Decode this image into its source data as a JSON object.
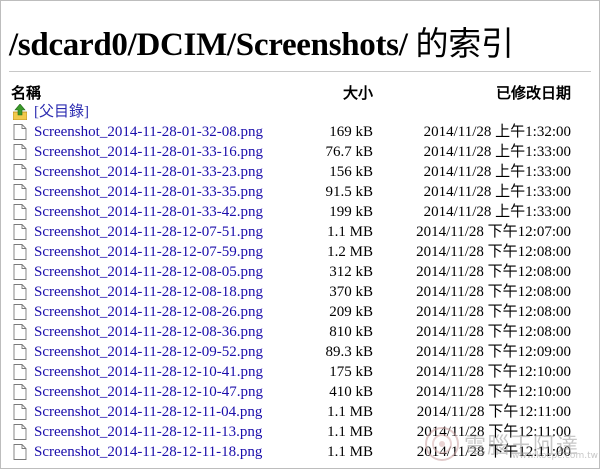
{
  "title": {
    "path": "/sdcard0/DCIM/Screenshots/",
    "suffix": " 的索引"
  },
  "headers": {
    "name": "名稱",
    "size": "大小",
    "date": "已修改日期"
  },
  "parent_link": "[父目錄]",
  "files": [
    {
      "name": "Screenshot_2014-11-28-01-32-08.png",
      "size": "169 kB",
      "date": "2014/11/28 上午1:32:00"
    },
    {
      "name": "Screenshot_2014-11-28-01-33-16.png",
      "size": "76.7 kB",
      "date": "2014/11/28 上午1:33:00"
    },
    {
      "name": "Screenshot_2014-11-28-01-33-23.png",
      "size": "156 kB",
      "date": "2014/11/28 上午1:33:00"
    },
    {
      "name": "Screenshot_2014-11-28-01-33-35.png",
      "size": "91.5 kB",
      "date": "2014/11/28 上午1:33:00"
    },
    {
      "name": "Screenshot_2014-11-28-01-33-42.png",
      "size": "199 kB",
      "date": "2014/11/28 上午1:33:00"
    },
    {
      "name": "Screenshot_2014-11-28-12-07-51.png",
      "size": "1.1 MB",
      "date": "2014/11/28 下午12:07:00"
    },
    {
      "name": "Screenshot_2014-11-28-12-07-59.png",
      "size": "1.2 MB",
      "date": "2014/11/28 下午12:08:00"
    },
    {
      "name": "Screenshot_2014-11-28-12-08-05.png",
      "size": "312 kB",
      "date": "2014/11/28 下午12:08:00"
    },
    {
      "name": "Screenshot_2014-11-28-12-08-18.png",
      "size": "370 kB",
      "date": "2014/11/28 下午12:08:00"
    },
    {
      "name": "Screenshot_2014-11-28-12-08-26.png",
      "size": "209 kB",
      "date": "2014/11/28 下午12:08:00"
    },
    {
      "name": "Screenshot_2014-11-28-12-08-36.png",
      "size": "810 kB",
      "date": "2014/11/28 下午12:08:00"
    },
    {
      "name": "Screenshot_2014-11-28-12-09-52.png",
      "size": "89.3 kB",
      "date": "2014/11/28 下午12:09:00"
    },
    {
      "name": "Screenshot_2014-11-28-12-10-41.png",
      "size": "175 kB",
      "date": "2014/11/28 下午12:10:00"
    },
    {
      "name": "Screenshot_2014-11-28-12-10-47.png",
      "size": "410 kB",
      "date": "2014/11/28 下午12:10:00"
    },
    {
      "name": "Screenshot_2014-11-28-12-11-04.png",
      "size": "1.1 MB",
      "date": "2014/11/28 下午12:11:00"
    },
    {
      "name": "Screenshot_2014-11-28-12-11-13.png",
      "size": "1.1 MB",
      "date": "2014/11/28 下午12:11:00"
    },
    {
      "name": "Screenshot_2014-11-28-12-11-18.png",
      "size": "1.1 MB",
      "date": "2014/11/28 下午12:11:00"
    }
  ],
  "watermark": {
    "text": "電腦王阿達",
    "url": "www.kocpc.com.tw"
  },
  "colors": {
    "link": "#1a0dab",
    "folder_arrow": "#e8a317",
    "folder_arrow_green": "#3a9a2a"
  },
  "icons": {
    "parent": "up-arrow-folder-icon",
    "file": "blank-file-icon"
  }
}
